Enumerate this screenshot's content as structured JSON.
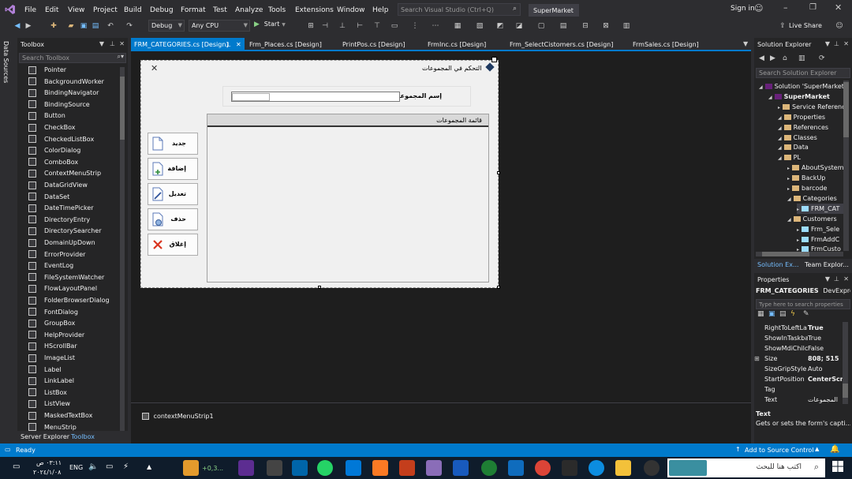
{
  "menu": {
    "items": [
      "File",
      "Edit",
      "View",
      "Project",
      "Build",
      "Debug",
      "Format",
      "Test",
      "Analyze",
      "Tools",
      "Extensions",
      "Window",
      "Help"
    ],
    "search_placeholder": "Search Visual Studio (Ctrl+Q)",
    "solution_name": "SuperMarket",
    "sign_in": "Sign in",
    "live_share": "Live Share"
  },
  "toolbar": {
    "config": "Debug",
    "platform": "Any CPU",
    "start": "Start"
  },
  "left_strip": {
    "label": "Data Sources"
  },
  "toolbox": {
    "title": "Toolbox",
    "search_placeholder": "Search Toolbox",
    "items": [
      "Pointer",
      "BackgroundWorker",
      "BindingNavigator",
      "BindingSource",
      "Button",
      "CheckBox",
      "CheckedListBox",
      "ColorDialog",
      "ComboBox",
      "ContextMenuStrip",
      "DataGridView",
      "DataSet",
      "DateTimePicker",
      "DirectoryEntry",
      "DirectorySearcher",
      "DomainUpDown",
      "ErrorProvider",
      "EventLog",
      "FileSystemWatcher",
      "FlowLayoutPanel",
      "FolderBrowserDialog",
      "FontDialog",
      "GroupBox",
      "HelpProvider",
      "HScrollBar",
      "ImageList",
      "Label",
      "LinkLabel",
      "ListBox",
      "ListView",
      "MaskedTextBox",
      "MenuStrip"
    ],
    "bottom_tabs": [
      "Server Explorer",
      "Toolbox"
    ]
  },
  "tabs": [
    "FRM_CATEGORIES.cs [Design]",
    "Frm_Places.cs [Design]",
    "PrintPos.cs [Design]",
    "FrmInc.cs [Design]",
    "Frm_SelectCistomers.cs [Design]",
    "FrmSales.cs [Design]"
  ],
  "form": {
    "title": "التحكم في المجموعات",
    "group_name_label": "إسم المجموعة :",
    "list_title": "قائمة المجموعات",
    "buttons": [
      "جديد",
      "إضافة",
      "تعديل",
      "حذف",
      "إغلاق"
    ],
    "component_tray": "contextMenuStrip1"
  },
  "solution_explorer": {
    "title": "Solution Explorer",
    "search_placeholder": "Search Solution Explorer",
    "items": [
      {
        "label": "Solution 'SuperMarket'",
        "level": 0
      },
      {
        "label": "SuperMarket",
        "level": 1
      },
      {
        "label": "Service Reference",
        "level": 2
      },
      {
        "label": "Properties",
        "level": 2
      },
      {
        "label": "References",
        "level": 2
      },
      {
        "label": "Classes",
        "level": 2
      },
      {
        "label": "Data",
        "level": 2
      },
      {
        "label": "PL",
        "level": 2
      },
      {
        "label": "AboutSystem",
        "level": 3
      },
      {
        "label": "BackUp",
        "level": 3
      },
      {
        "label": "barcode",
        "level": 3
      },
      {
        "label": "Categories",
        "level": 3
      },
      {
        "label": "FRM_CAT",
        "level": 4
      },
      {
        "label": "Customers",
        "level": 3
      },
      {
        "label": "Frm_Sele",
        "level": 4
      },
      {
        "label": "FrmAddC",
        "level": 4
      },
      {
        "label": "FrmCusto",
        "level": 4
      }
    ],
    "bottom_tabs": [
      "Solution Ex...",
      "Team Explor..."
    ]
  },
  "properties": {
    "title": "Properties",
    "object": "FRM_CATEGORIES",
    "object_type": "DevExpre",
    "search_placeholder": "Type here to search properties",
    "rows": [
      {
        "k": "RightToLeftLa",
        "v": "True"
      },
      {
        "k": "ShowInTaskba",
        "v": "True"
      },
      {
        "k": "ShowMdiChilc",
        "v": "False"
      },
      {
        "k": "Size",
        "v": "808; 515"
      },
      {
        "k": "SizeGripStyle",
        "v": "Auto"
      },
      {
        "k": "StartPosition",
        "v": "CenterScre"
      },
      {
        "k": "Tag",
        "v": ""
      },
      {
        "k": "Text",
        "v": "المجموعات"
      }
    ],
    "desc_title": "Text",
    "desc_text": "Gets or sets the form's capti..."
  },
  "status": {
    "left": "Ready",
    "right": "Add to Source Control"
  },
  "taskbar": {
    "time": "٠٣:١١ ص",
    "date": "٢٠٢٤/١/٠٨",
    "lang": "ENG",
    "search_placeholder": "اكتب هنا للبحث",
    "weather": "+0,3..."
  },
  "colors": {
    "accent": "#007acc",
    "bg": "#2d2d30",
    "designer": "#1e1e1e",
    "form": "#f0f0f0"
  }
}
